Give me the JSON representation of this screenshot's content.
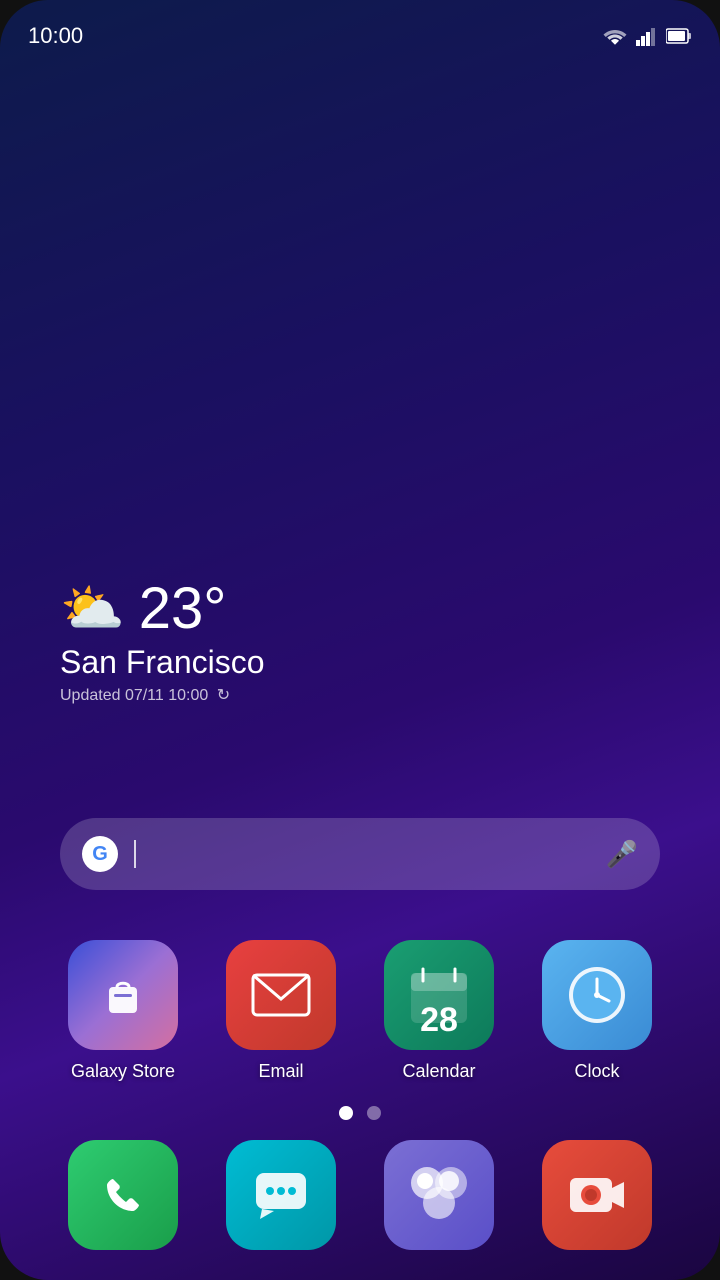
{
  "statusBar": {
    "time": "10:00"
  },
  "weather": {
    "icon": "⛅",
    "temp": "23°",
    "city": "San Francisco",
    "updated": "Updated 07/11 10:00"
  },
  "search": {
    "placeholder": "",
    "googleLetter": "G"
  },
  "apps": [
    {
      "id": "galaxy-store",
      "label": "Galaxy Store",
      "iconType": "galaxy"
    },
    {
      "id": "email",
      "label": "Email",
      "iconType": "email"
    },
    {
      "id": "calendar",
      "label": "Calendar",
      "iconType": "calendar",
      "calNumber": "28"
    },
    {
      "id": "clock",
      "label": "Clock",
      "iconType": "clock"
    }
  ],
  "bottomApps": [
    {
      "id": "phone",
      "label": "",
      "iconType": "phone"
    },
    {
      "id": "messages",
      "label": "",
      "iconType": "messages"
    },
    {
      "id": "games",
      "label": "",
      "iconType": "games"
    },
    {
      "id": "camera",
      "label": "",
      "iconType": "camera"
    }
  ],
  "pageDots": {
    "active": 0,
    "total": 2
  }
}
